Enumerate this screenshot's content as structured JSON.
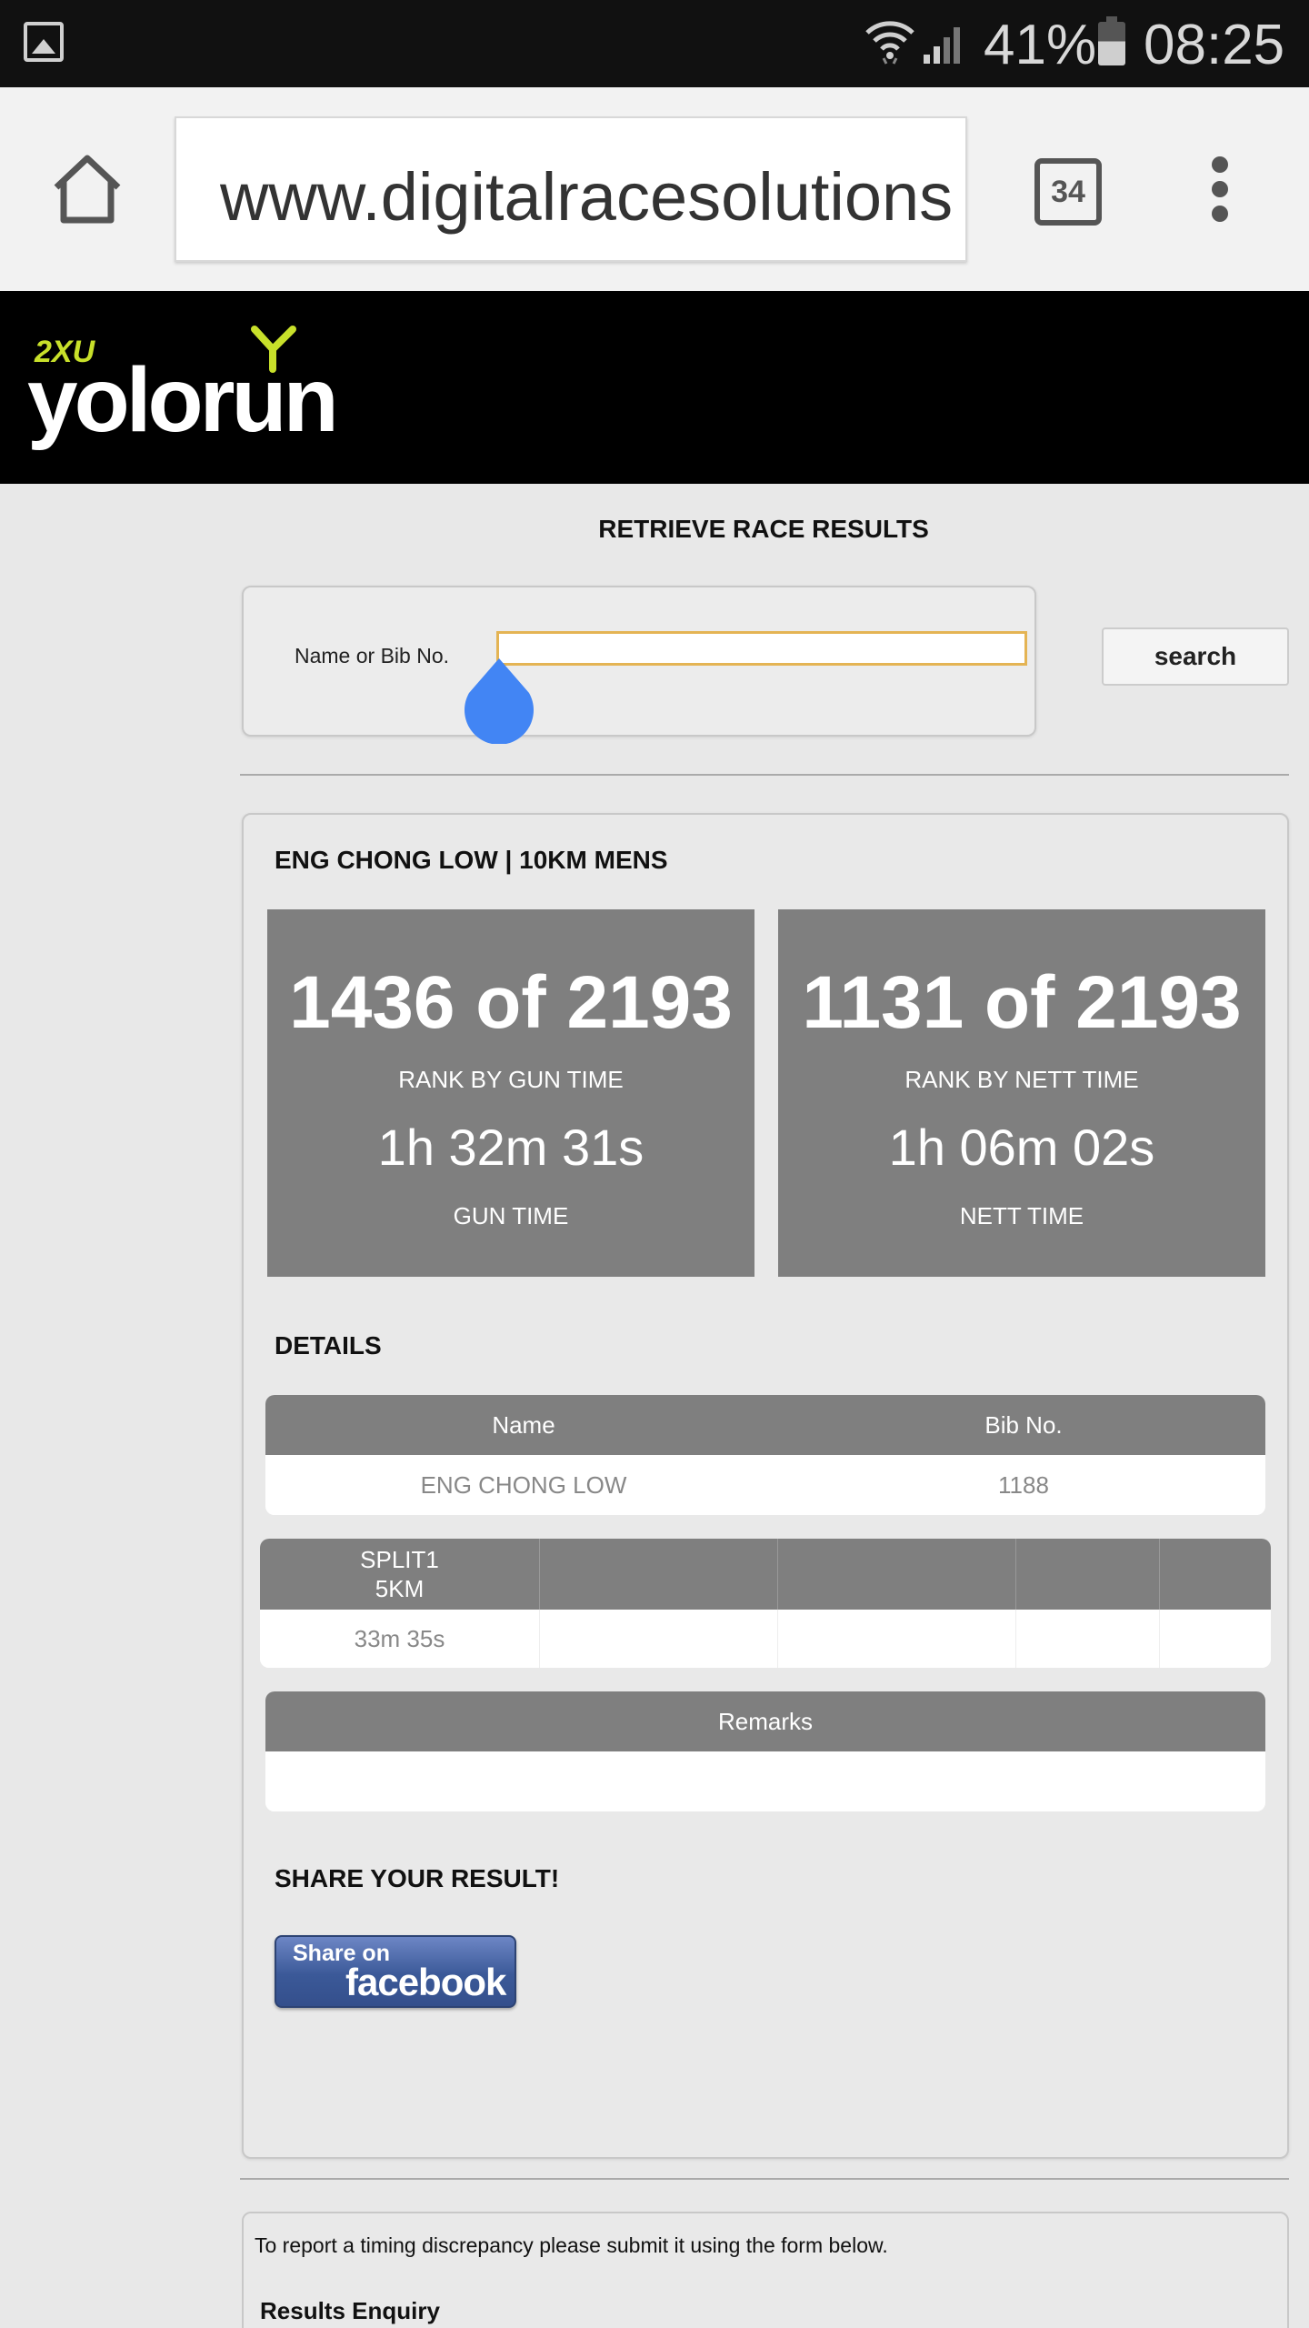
{
  "status_bar": {
    "battery_percent": "41%",
    "time": "08:25",
    "icons": [
      "gallery-icon",
      "wifi-icon",
      "signal-icon",
      "battery-icon"
    ]
  },
  "browser": {
    "url": "www.digitalracesolutions",
    "tab_count": "34",
    "icons": [
      "home-icon",
      "tabs-icon",
      "overflow-menu-icon"
    ]
  },
  "site": {
    "logo_text": "yolorun",
    "logo_brand": "2XU"
  },
  "search": {
    "title": "RETRIEVE RACE RESULTS",
    "label": "Name or Bib No.",
    "input_value": "",
    "button_label": "search"
  },
  "result": {
    "runner_heading": "ENG CHONG LOW | 10KM MENS",
    "gun": {
      "rank": "1436 of 2193",
      "rank_label": "RANK BY GUN TIME",
      "time": "1h 32m 31s",
      "time_label": "GUN TIME"
    },
    "nett": {
      "rank": "1131 of 2193",
      "rank_label": "RANK BY NETT TIME",
      "time": "1h 06m 02s",
      "time_label": "NETT TIME"
    },
    "details_title": "DETAILS",
    "details_table": {
      "headers": [
        "Name",
        "Bib No."
      ],
      "row": [
        "ENG CHONG LOW",
        "1188"
      ]
    },
    "splits_table": {
      "headers": [
        [
          "SPLIT1",
          "5KM"
        ],
        [
          "",
          ""
        ],
        [
          "",
          ""
        ],
        [
          "",
          ""
        ],
        [
          "",
          ""
        ]
      ],
      "row": [
        "33m 35s",
        "",
        "",
        "",
        ""
      ]
    },
    "remarks_table": {
      "header": "Remarks",
      "value": ""
    },
    "share_title": "SHARE YOUR RESULT!",
    "facebook_button": {
      "small": "Share on",
      "big": "facebook"
    }
  },
  "enquiry": {
    "text": "To report a timing discrepancy please submit it using the form below.",
    "title": "Results Enquiry"
  },
  "colors": {
    "logo_accent": "#c8e02a",
    "input_border": "#e4b454",
    "rank_box": "#7f7f7f",
    "facebook": "#3b5998",
    "drop_handle": "#4285f4"
  }
}
